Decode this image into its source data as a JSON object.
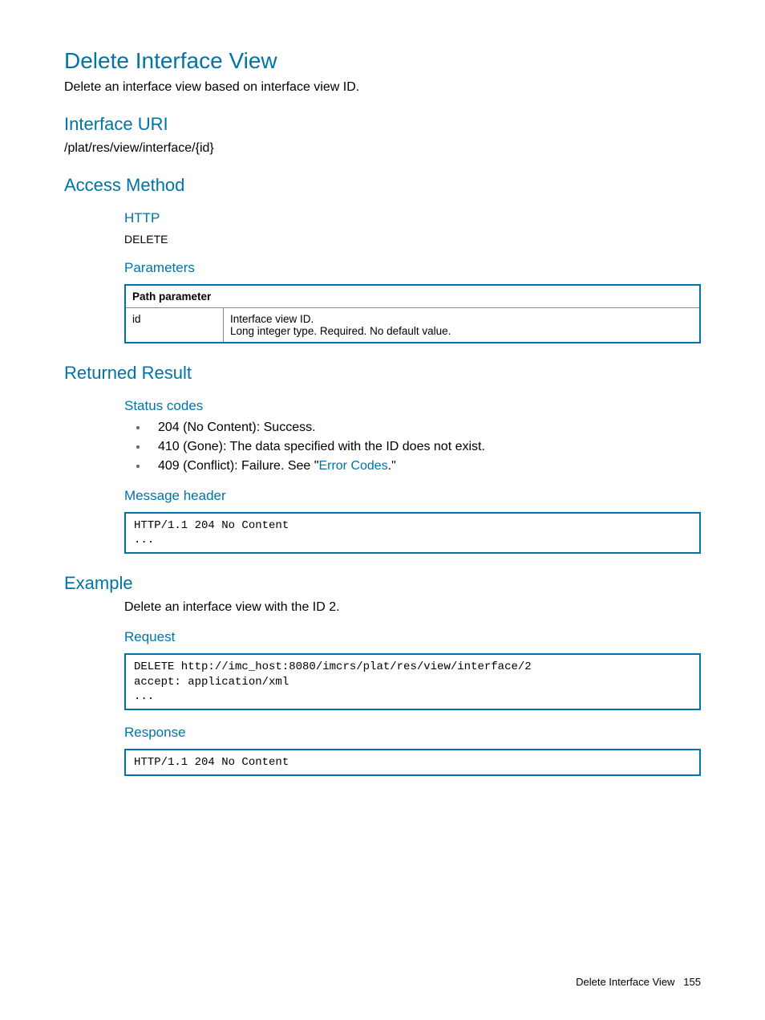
{
  "title": "Delete Interface View",
  "intro": "Delete an interface view based on interface view ID.",
  "interfaceUri": {
    "heading": "Interface URI",
    "value": "/plat/res/view/interface/{id}"
  },
  "accessMethod": {
    "heading": "Access Method",
    "httpLabel": "HTTP",
    "httpValue": "DELETE",
    "parametersLabel": "Parameters",
    "table": {
      "header": "Path parameter",
      "rowName": "id",
      "rowDesc1": "Interface view ID.",
      "rowDesc2": "Long integer type. Required. No default value."
    }
  },
  "returnedResult": {
    "heading": "Returned Result",
    "statusCodesLabel": "Status codes",
    "codes": [
      "204 (No Content): Success.",
      "410 (Gone): The data specified with the ID does not exist."
    ],
    "code409Prefix": "409 (Conflict): Failure. See \"",
    "code409Link": "Error Codes",
    "code409Suffix": ".\"",
    "messageHeaderLabel": "Message header",
    "messageHeaderCode": "HTTP/1.1 204 No Content\n..."
  },
  "example": {
    "heading": "Example",
    "intro": "Delete an interface view with the ID 2.",
    "requestLabel": "Request",
    "requestCode": "DELETE http://imc_host:8080/imcrs/plat/res/view/interface/2\naccept: application/xml\n...",
    "responseLabel": "Response",
    "responseCode": "HTTP/1.1 204 No Content"
  },
  "footer": {
    "title": "Delete Interface View",
    "page": "155"
  }
}
